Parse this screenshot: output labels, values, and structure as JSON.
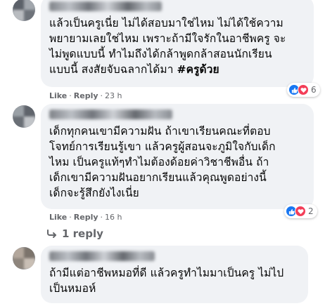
{
  "comments": [
    {
      "text_lines": [
        "แล้วเป็นครูเนี่ย ไม่ได้สอบมาใช่ไหม ไม่ได้ใช้ความ",
        "พยายามเลยใช่ไหม เพราะถ้ามีใจรักในอาชีพครู จะ",
        "ไม่พูดแบบนี้ ทำไมถึงได้กล้าพูดกล้าสอนนักเรียน",
        "แบบนี้ สงสัยจับฉลากได้มา "
      ],
      "hashtag": "#ครูด้วย",
      "like_label": "Like",
      "reply_label": "Reply",
      "time": "23 h",
      "reaction_count": "6",
      "reaction_icons": [
        "like-icon",
        "love-icon"
      ]
    },
    {
      "text_lines": [
        "เด็กทุกคนเขามีความฝัน ถ้าเขาเรียนคณะที่ตอบ",
        "โจทย์การเรียนรู้เขา แล้วครูผู้สอนจะภูมิใจกับเด็ก",
        "ไหม เป็นครูแท้ๆทำไมต้องด้อยค่าวิชาชีพอื่น ถ้า",
        "เด็กเขามีความฝันอยากเรียนแล้วคุณพูดอย่างนี้",
        "เด็กจะรู้สึกยังไงเนี่ย"
      ],
      "like_label": "Like",
      "reply_label": "Reply",
      "time": "16 h",
      "reaction_count": "2",
      "reaction_icons": [
        "like-icon",
        "love-icon"
      ],
      "replies_label": "1 reply",
      "replies_icon": "reply-arrow-icon"
    },
    {
      "text_lines": [
        "ถ้ามีแต่อาชีพหมอที่ดี แล้วครูทำไมมาเป็นครู ไม่ไป",
        "เป็นหมอห์"
      ]
    }
  ],
  "separator": "·",
  "colors": {
    "bubble": "#f0f2f5",
    "meta_text": "#65676b",
    "like_blue": "#1877f2",
    "love_red": "#f33e58"
  }
}
